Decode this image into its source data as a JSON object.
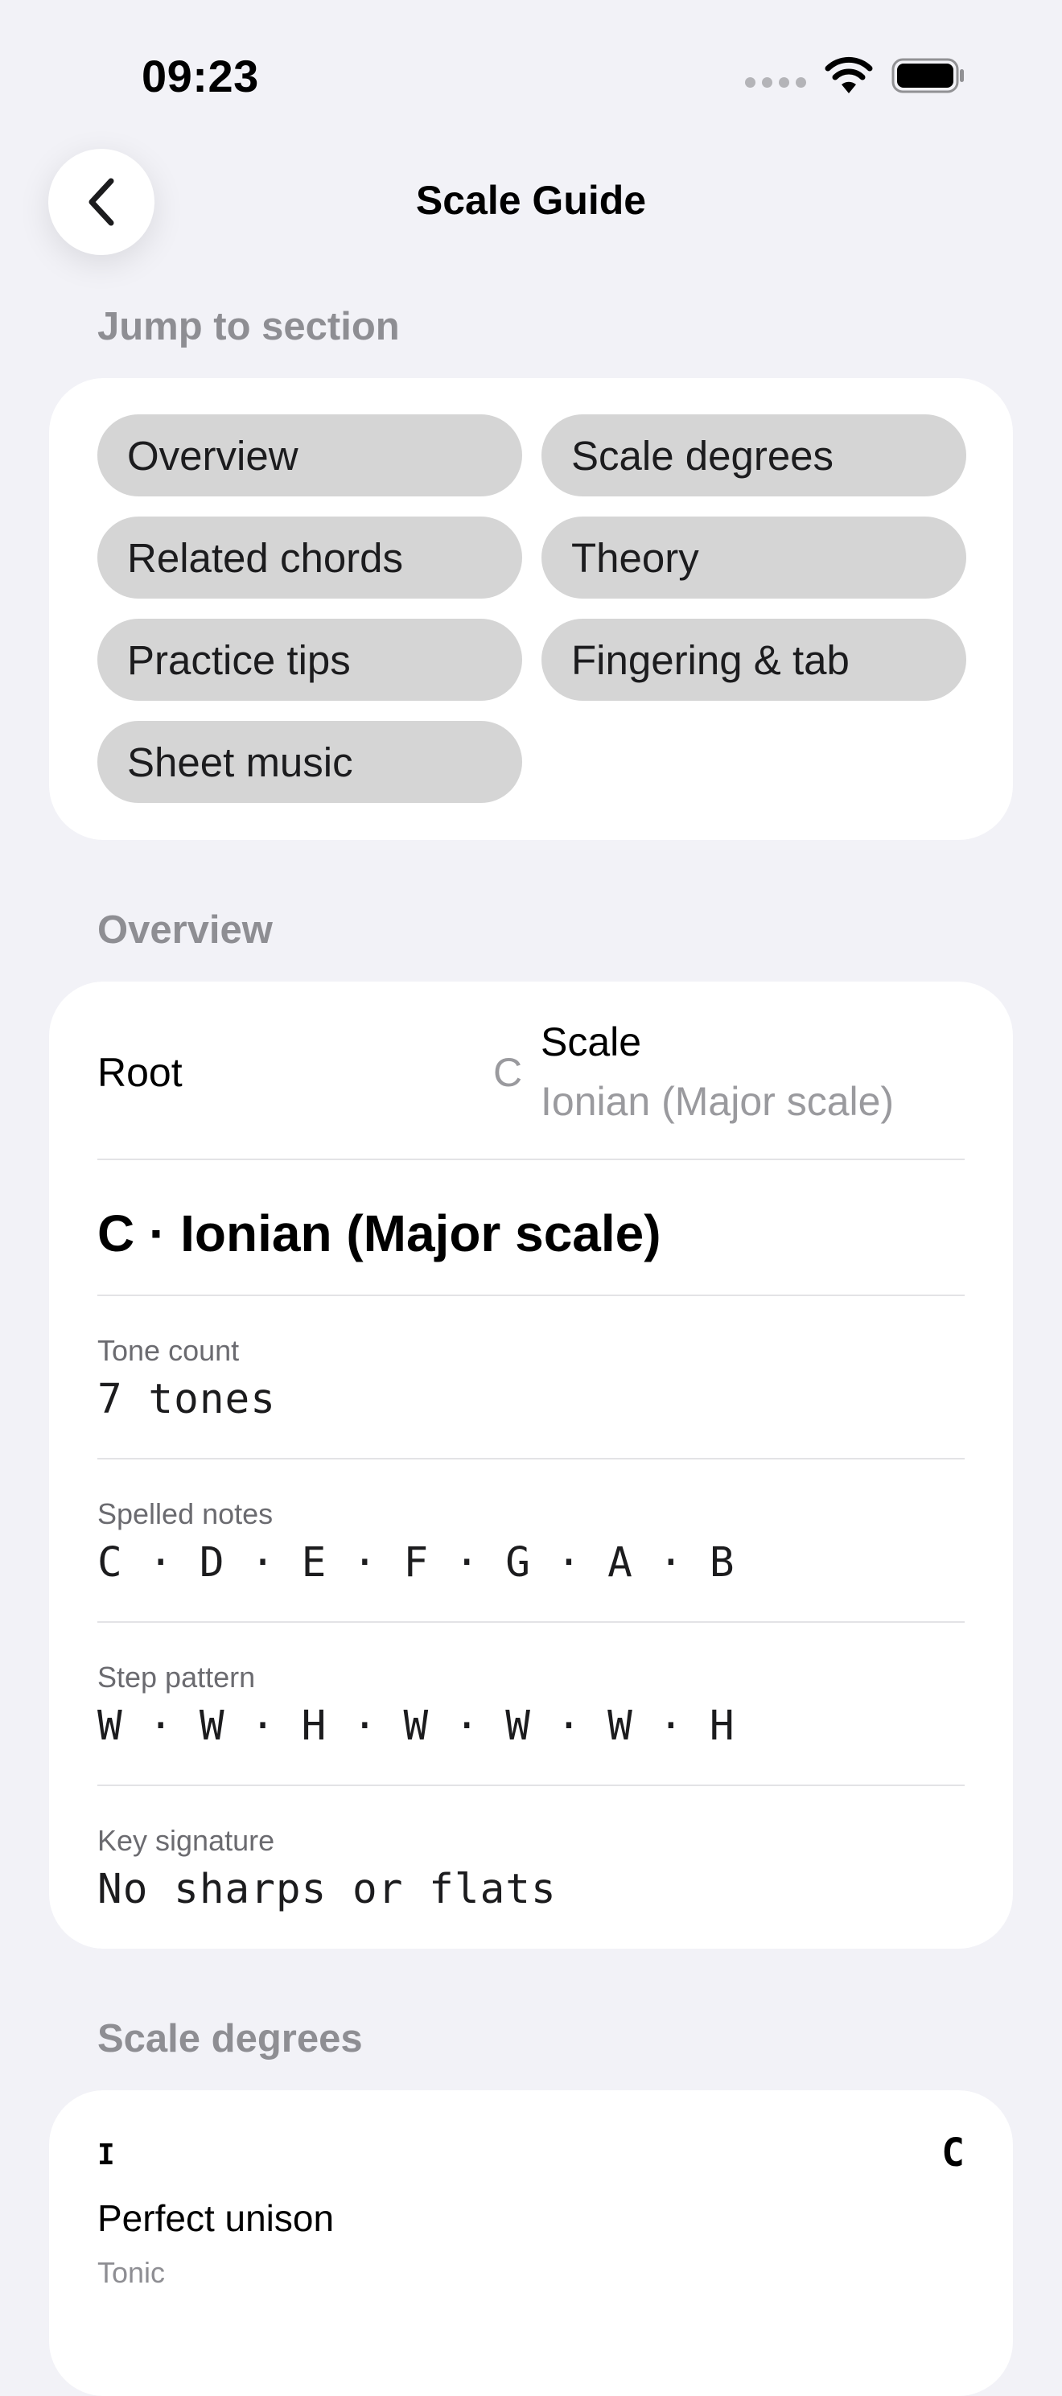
{
  "status_bar": {
    "time": "09:23",
    "icons": [
      "signal-dots-icon",
      "wifi-icon",
      "battery-icon"
    ]
  },
  "nav": {
    "title": "Scale Guide",
    "back_icon": "chevron-left-icon"
  },
  "jump_section": {
    "label": "Jump to section",
    "chips": [
      "Overview",
      "Scale degrees",
      "Related chords",
      "Theory",
      "Practice tips",
      "Fingering & tab",
      "Sheet music"
    ]
  },
  "overview": {
    "label": "Overview",
    "root_label": "Root",
    "root_value": "C",
    "scale_label": "Scale",
    "scale_value": "Ionian (Major scale)",
    "heading": "C · Ionian (Major scale)",
    "fields": [
      {
        "caption": "Tone count",
        "value": "7 tones"
      },
      {
        "caption": "Spelled notes",
        "value": "C · D · E · F · G · A · B"
      },
      {
        "caption": "Step pattern",
        "value": "W · W · H · W · W · W · H"
      },
      {
        "caption": "Key signature",
        "value": "No sharps or flats"
      }
    ]
  },
  "scale_degrees": {
    "label": "Scale degrees",
    "items": [
      {
        "numeral": "I",
        "note": "C",
        "name": "Perfect unison",
        "role": "Tonic"
      }
    ]
  },
  "colors": {
    "background": "#F2F2F7",
    "card": "#FFFFFF",
    "chip": "#D5D5D5",
    "secondary_text": "#8E8E93"
  }
}
